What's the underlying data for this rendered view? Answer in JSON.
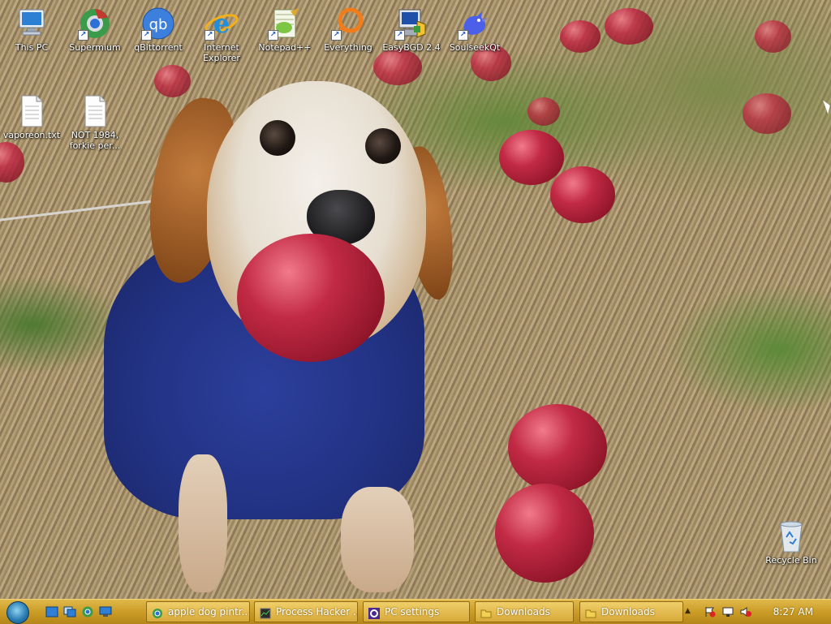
{
  "desktop": {
    "icons": [
      {
        "label": "This PC",
        "icon": "computer-icon"
      },
      {
        "label": "Supermium",
        "icon": "browser-globe-icon"
      },
      {
        "label": "qBittorrent",
        "icon": "qbittorrent-icon"
      },
      {
        "label": "Internet Explorer",
        "icon": "internet-explorer-icon"
      },
      {
        "label": "Notepad++",
        "icon": "notepad-plus-plus-icon"
      },
      {
        "label": "Everything",
        "icon": "everything-search-icon"
      },
      {
        "label": "EasyBGD 2.4",
        "icon": "easybgd-icon"
      },
      {
        "label": "SoulseekQt",
        "icon": "soulseek-bird-icon"
      },
      {
        "label": "vaporeon.txt",
        "icon": "text-file-icon"
      },
      {
        "label": "NOT 1984, forkie per...",
        "icon": "text-file-icon"
      },
      {
        "label": "Recycle Bin",
        "icon": "recycle-bin-icon"
      }
    ]
  },
  "taskbar": {
    "quick_launch": [
      "show-desktop-icon",
      "window-switcher-icon",
      "browser-icon",
      "desktop-icon"
    ],
    "tasks": [
      {
        "label": "apple dog pintr...",
        "icon": "browser-icon"
      },
      {
        "label": "Process Hacker ...",
        "icon": "process-hacker-icon"
      },
      {
        "label": "PC settings",
        "icon": "gear-icon"
      },
      {
        "label": "Downloads",
        "icon": "folder-icon"
      },
      {
        "label": "Downloads",
        "icon": "folder-icon"
      }
    ],
    "tray": {
      "icons": [
        "show-hidden-icons-chevron",
        "action-center-flag-icon",
        "network-icon",
        "volume-muted-icon"
      ],
      "chevron": "▲",
      "clock": "8:27 AM"
    }
  },
  "colors": {
    "taskbar": "#c99a24",
    "taskbar_highlight": "#f0cf6a",
    "task_text": "#ffffff",
    "sweater": "#223283",
    "apple": "#c22a44"
  }
}
